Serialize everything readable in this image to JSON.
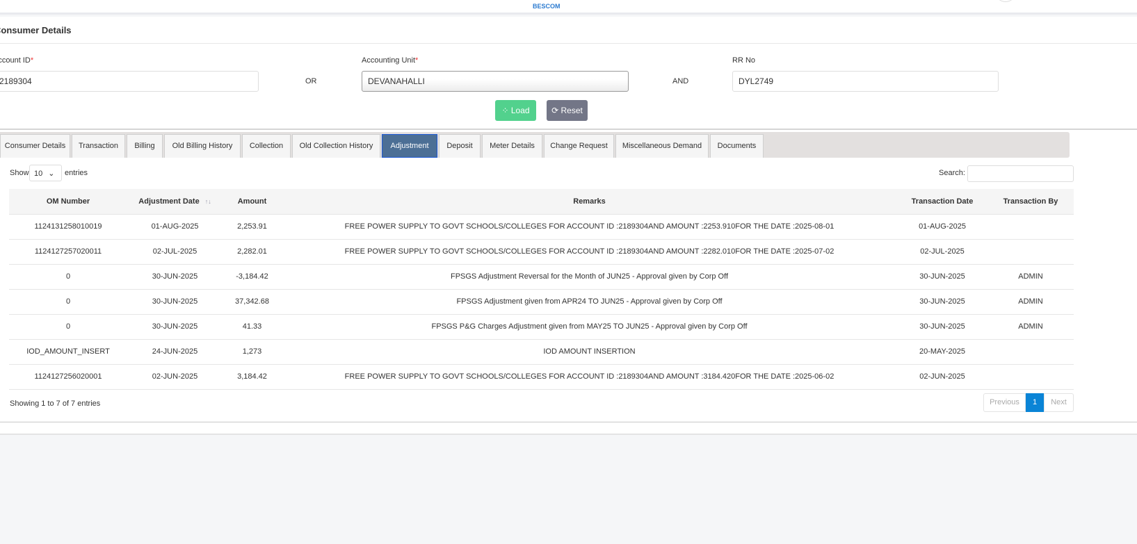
{
  "header": {
    "logo_text": "BESCOM"
  },
  "card": {
    "title": "Consumer Details"
  },
  "form": {
    "account_id_label": "Account ID",
    "account_id_value": "2189304",
    "or": "OR",
    "accounting_unit_label": "Accounting Unit",
    "accounting_unit_value": "DEVANAHALLI",
    "and": "AND",
    "rr_no_label": "RR No",
    "rr_no_value": "DYL2749",
    "required_mark": "*",
    "load_label": "Load",
    "reset_label": "Reset"
  },
  "tabs": [
    "Consumer Details",
    "Transaction",
    "Billing",
    "Old Billing History",
    "Collection",
    "Old Collection History",
    "Adjustment",
    "Deposit",
    "Meter Details",
    "Change Request",
    "Miscellaneous Demand",
    "Documents"
  ],
  "active_tab": "Adjustment",
  "table_controls": {
    "show": "Show",
    "page_length": "10",
    "entries": "entries",
    "search_label": "Search:"
  },
  "table": {
    "columns": [
      "OM Number",
      "Adjustment Date",
      "Amount",
      "Remarks",
      "Transaction Date",
      "Transaction By"
    ],
    "rows": [
      [
        "1124131258010019",
        "01-AUG-2025",
        "2,253.91",
        "FREE POWER SUPPLY TO GOVT SCHOOLS/COLLEGES FOR ACCOUNT ID :2189304AND AMOUNT :2253.910FOR THE DATE :2025-08-01",
        "01-AUG-2025",
        ""
      ],
      [
        "1124127257020011",
        "02-JUL-2025",
        "2,282.01",
        "FREE POWER SUPPLY TO GOVT SCHOOLS/COLLEGES FOR ACCOUNT ID :2189304AND AMOUNT :2282.010FOR THE DATE :2025-07-02",
        "02-JUL-2025",
        ""
      ],
      [
        "0",
        "30-JUN-2025",
        "-3,184.42",
        "FPSGS Adjustment Reversal for the Month of JUN25 - Approval given by Corp Off",
        "30-JUN-2025",
        "ADMIN"
      ],
      [
        "0",
        "30-JUN-2025",
        "37,342.68",
        "FPSGS Adjustment given from APR24 TO JUN25 - Approval given by Corp Off",
        "30-JUN-2025",
        "ADMIN"
      ],
      [
        "0",
        "30-JUN-2025",
        "41.33",
        "FPSGS P&G Charges Adjustment given from MAY25 TO JUN25 - Approval given by Corp Off",
        "30-JUN-2025",
        "ADMIN"
      ],
      [
        "IOD_AMOUNT_INSERT",
        "24-JUN-2025",
        "1,273",
        "IOD AMOUNT INSERTION",
        "20-MAY-2025",
        ""
      ],
      [
        "1124127256020001",
        "02-JUN-2025",
        "3,184.42",
        "FREE POWER SUPPLY TO GOVT SCHOOLS/COLLEGES FOR ACCOUNT ID :2189304AND AMOUNT :3184.420FOR THE DATE :2025-06-02",
        "02-JUN-2025",
        ""
      ]
    ]
  },
  "footer": {
    "info": "Showing 1 to 7 of 7 entries",
    "previous": "Previous",
    "page": "1",
    "next": "Next"
  }
}
